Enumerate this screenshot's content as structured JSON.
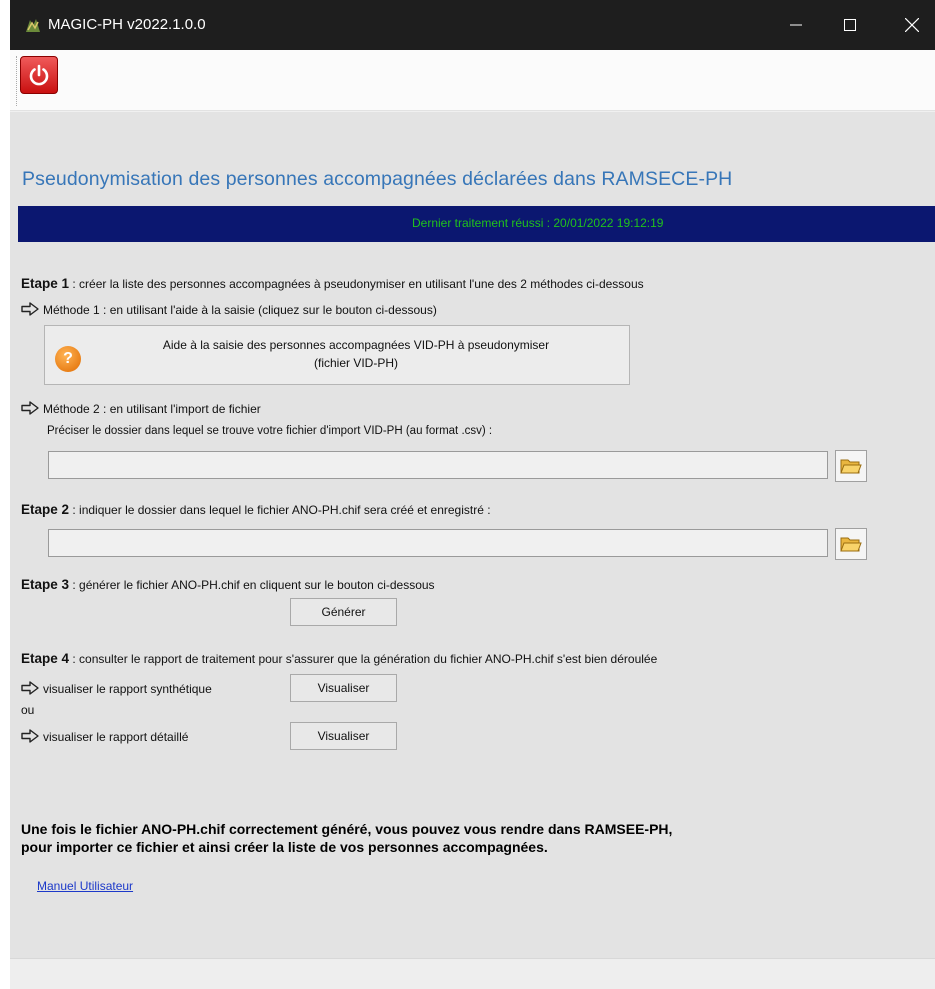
{
  "window": {
    "title": "MAGIC-PH  v2022.1.0.0",
    "controls": {
      "minimize": "—",
      "maximize": "☐",
      "close": "✕"
    }
  },
  "toolbar": {
    "power_icon": "power-icon"
  },
  "main": {
    "heading": "Pseudonymisation des personnes accompagnées déclarées dans RAMSECE-PH",
    "status": "Dernier traitement réussi : 20/01/2022 19:12:19",
    "step1": {
      "bold": "Etape 1",
      "text": " : créer la liste des personnes accompagnées à pseudonymiser en utilisant l'une des 2 méthodes ci-dessous"
    },
    "method1": "Méthode 1 : en utilisant l'aide à la saisie (cliquez sur le bouton ci-dessous)",
    "help_button": "Aide à la saisie des personnes accompagnées VID-PH à pseudonymiser\n(fichier VID-PH)",
    "method2": "Méthode 2 : en utilisant l'import de fichier",
    "import_hint": "Préciser le dossier dans lequel se trouve votre fichier d'import VID-PH (au format .csv) :",
    "import_path": "",
    "step2": {
      "bold": "Etape 2",
      "text": " : indiquer le dossier dans lequel le fichier ANO-PH.chif sera créé et enregistré :"
    },
    "output_path": "",
    "step3": {
      "bold": "Etape 3",
      "text": " : générer le fichier ANO-PH.chif en cliquent sur le bouton ci-dessous"
    },
    "generate_button": "Générer",
    "step4": {
      "bold": "Etape 4",
      "text": " : consulter le rapport de traitement pour s'assurer que la génération du fichier ANO-PH.chif s'est bien déroulée"
    },
    "report_summary": "visualiser le rapport synthétique",
    "view_button_1": "Visualiser",
    "or": "ou",
    "report_detail": "visualiser le rapport détaillé",
    "view_button_2": "Visualiser",
    "note": "Une fois le fichier ANO-PH.chif correctement généré, vous pouvez vous rendre dans RAMSEE-PH,\npour importer ce fichier et ainsi créer la liste de vos personnes accompagnées.",
    "manual_link": "Manuel Utilisateur"
  },
  "colors": {
    "heading": "#3776b8",
    "status_bg": "#0b1770",
    "status_text": "#20c01d",
    "link": "#1c39c9"
  }
}
